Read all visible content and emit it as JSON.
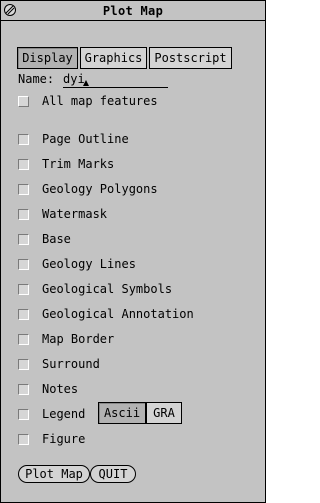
{
  "window": {
    "title": "Plot Map"
  },
  "tabs": [
    {
      "label": "Display",
      "active": true
    },
    {
      "label": "Graphics",
      "active": false
    },
    {
      "label": "Postscript",
      "active": false
    }
  ],
  "name_field": {
    "label": "Name:",
    "value": "dyi"
  },
  "items": [
    {
      "label": "All map features"
    },
    {
      "label": "Page Outline"
    },
    {
      "label": "Trim Marks"
    },
    {
      "label": "Geology Polygons"
    },
    {
      "label": "Watermask"
    },
    {
      "label": "Base"
    },
    {
      "label": "Geology Lines"
    },
    {
      "label": "Geological Symbols"
    },
    {
      "label": "Geological Annotation"
    },
    {
      "label": "Map Border"
    },
    {
      "label": "Surround"
    },
    {
      "label": "Notes"
    },
    {
      "label": "Legend"
    },
    {
      "label": "Figure"
    }
  ],
  "legend_options": [
    {
      "label": "Ascii",
      "active": true
    },
    {
      "label": "GRA",
      "active": false
    }
  ],
  "buttons": {
    "plot_map": "Plot Map",
    "quit": "QUIT"
  },
  "colors": {
    "background": "#c3c3c3",
    "button": "#d4d4d4",
    "active": "#b2b2b2"
  }
}
